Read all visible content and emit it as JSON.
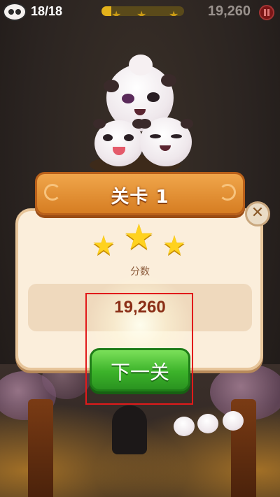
{
  "top_bar": {
    "moves": "18/18",
    "score": "19,260",
    "star_progress": 0.12
  },
  "dialog": {
    "title": "关卡 1",
    "stars_earned": 3,
    "stars_total": 3,
    "score_label": "分数",
    "score_value": "19,260",
    "next_button_label": "下一关",
    "close_icon": "close-icon"
  },
  "colors": {
    "banner_orange": "#e2902f",
    "button_green": "#3cb32a",
    "score_red": "#8a2e16",
    "highlight_red": "#e11a1a"
  }
}
